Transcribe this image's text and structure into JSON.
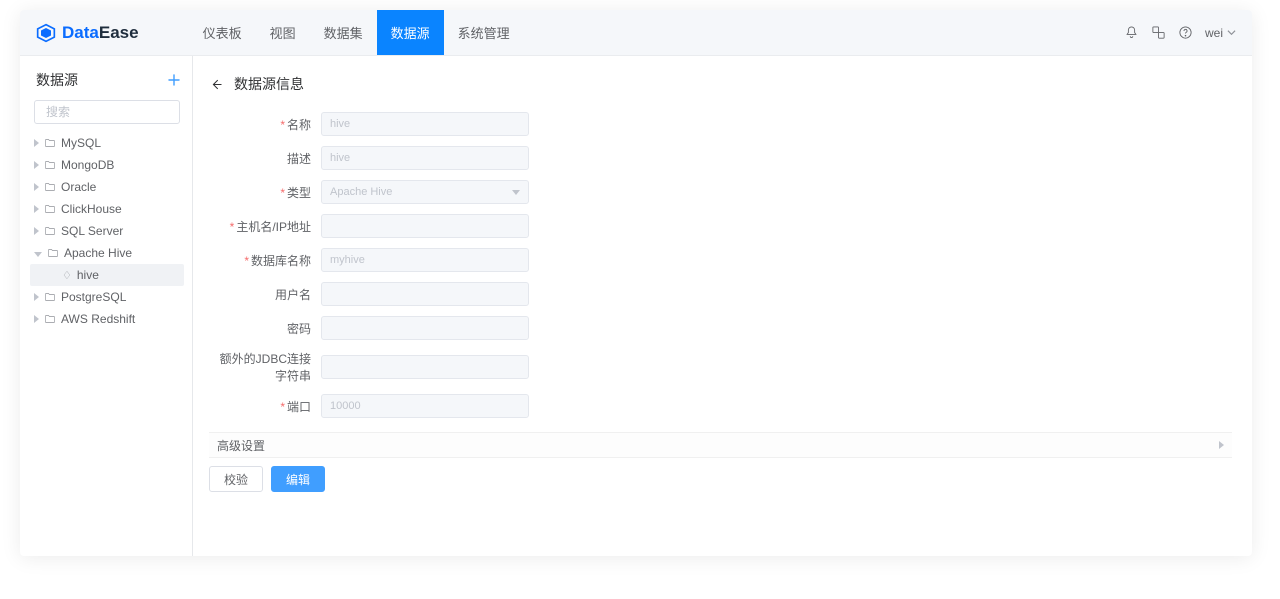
{
  "logo": {
    "brand1": "Data",
    "brand2": "Ease"
  },
  "nav": {
    "items": [
      {
        "label": "仪表板"
      },
      {
        "label": "视图"
      },
      {
        "label": "数据集"
      },
      {
        "label": "数据源"
      },
      {
        "label": "系统管理"
      }
    ],
    "active_index": 3
  },
  "topright": {
    "username": "wei"
  },
  "sidebar": {
    "title": "数据源",
    "search_placeholder": "搜索",
    "items": [
      {
        "label": "MySQL"
      },
      {
        "label": "MongoDB"
      },
      {
        "label": "Oracle"
      },
      {
        "label": "ClickHouse"
      },
      {
        "label": "SQL Server"
      },
      {
        "label": "Apache Hive",
        "expanded": true,
        "children": [
          {
            "label": "hive"
          }
        ]
      },
      {
        "label": "PostgreSQL"
      },
      {
        "label": "AWS Redshift"
      }
    ]
  },
  "main": {
    "title": "数据源信息",
    "fields": {
      "name": {
        "label": "名称",
        "required": true,
        "value": "hive"
      },
      "desc": {
        "label": "描述",
        "required": false,
        "value": "hive"
      },
      "type": {
        "label": "类型",
        "required": true,
        "value": "Apache Hive"
      },
      "host": {
        "label": "主机名/IP地址",
        "required": true,
        "value": ""
      },
      "dbname": {
        "label": "数据库名称",
        "required": true,
        "value": "myhive"
      },
      "user": {
        "label": "用户名",
        "required": false,
        "value": ""
      },
      "pass": {
        "label": "密码",
        "required": false,
        "value": ""
      },
      "jdbc": {
        "label": "额外的JDBC连接字符串",
        "required": false,
        "value": ""
      },
      "port": {
        "label": "端口",
        "required": true,
        "value": "10000"
      }
    },
    "advanced_label": "高级设置",
    "buttons": {
      "validate": "校验",
      "edit": "编辑"
    }
  }
}
